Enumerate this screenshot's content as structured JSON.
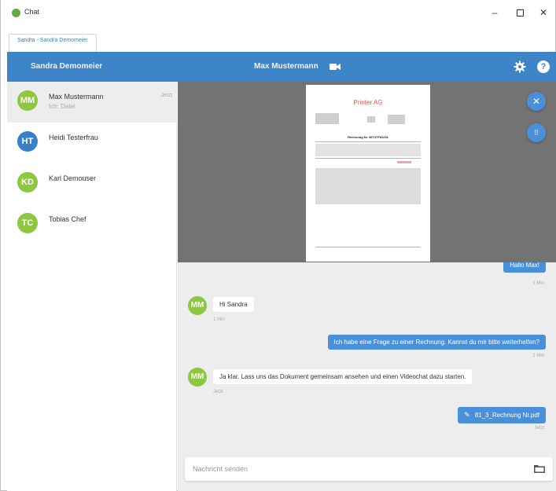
{
  "window": {
    "title": "Chat"
  },
  "tabs": [
    {
      "label": "Sandra - Sandra Demomeier"
    }
  ],
  "topbar": {
    "current_user": "Sandra Demomeier",
    "chat_partner": "Max Mustermann",
    "icons": [
      "video-icon",
      "gear-icon",
      "help-icon"
    ]
  },
  "contacts": [
    {
      "initials": "MM",
      "name": "Max Mustermann",
      "last_message": "Ich: Datei",
      "time": "Jetzt",
      "color": "#8dc63f",
      "active": true
    },
    {
      "initials": "HT",
      "name": "Heidi Testerfrau",
      "last_message": "",
      "time": "",
      "color": "#3a7fc6",
      "active": false
    },
    {
      "initials": "KD",
      "name": "Karl Demouser",
      "last_message": "",
      "time": "",
      "color": "#8dc63f",
      "active": false
    },
    {
      "initials": "TC",
      "name": "Tobias Chef",
      "last_message": "",
      "time": "",
      "color": "#8dc63f",
      "active": false
    }
  ],
  "document": {
    "company": "Printer AG",
    "heading": "Rechnung Nr. 86747F81231"
  },
  "messages": [
    {
      "direction": "out",
      "text": "Hallo Max!",
      "time": "1 Min"
    },
    {
      "direction": "in",
      "initials": "MM",
      "text": "Hi Sandra",
      "time": "1 Min"
    },
    {
      "direction": "out",
      "text": "Ich habe eine Frage zu einer Rechnung. Kannst du mir bitte weiterhelfen?",
      "time": "1 Min"
    },
    {
      "direction": "in",
      "initials": "MM",
      "text": "Ja klar. Lass uns das Dokument gemeinsam ansehen und einen Videochat dazu starten.",
      "time": "Jetzt"
    },
    {
      "direction": "out",
      "text": "81_3_Rechnung Nr.pdf",
      "time": "Jetzt",
      "attachment": true
    }
  ],
  "composer": {
    "placeholder": "Nachricht senden"
  },
  "colors": {
    "accent": "#3d85c6",
    "bubble_out": "#4a90d9",
    "avatar_green": "#8dc63f",
    "doc_title": "#d9534f"
  }
}
